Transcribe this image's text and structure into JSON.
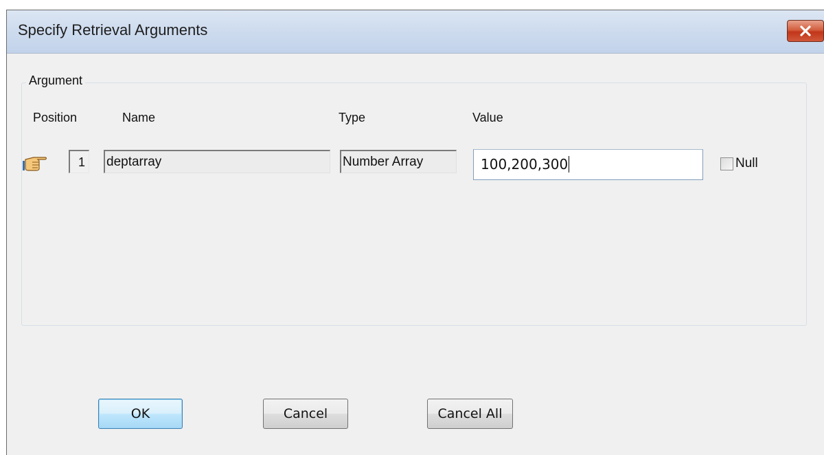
{
  "window": {
    "title": "Specify Retrieval Arguments",
    "close_icon": "close-icon"
  },
  "argument_group": {
    "label": "Argument",
    "columns": {
      "position": "Position",
      "name": "Name",
      "type": "Type",
      "value": "Value"
    },
    "rows": [
      {
        "indicator_icon": "pointing-hand-icon",
        "position": "1",
        "name": "deptarray",
        "type": "Number Array",
        "value": "100,200,300",
        "null_label": "Null",
        "null_checked": false
      }
    ]
  },
  "buttons": {
    "ok": "OK",
    "cancel": "Cancel",
    "cancel_all": "Cancel All"
  },
  "colors": {
    "titlebar": "#cddbee",
    "close_button": "#c2371a",
    "default_button_border": "#3c7fb1"
  }
}
